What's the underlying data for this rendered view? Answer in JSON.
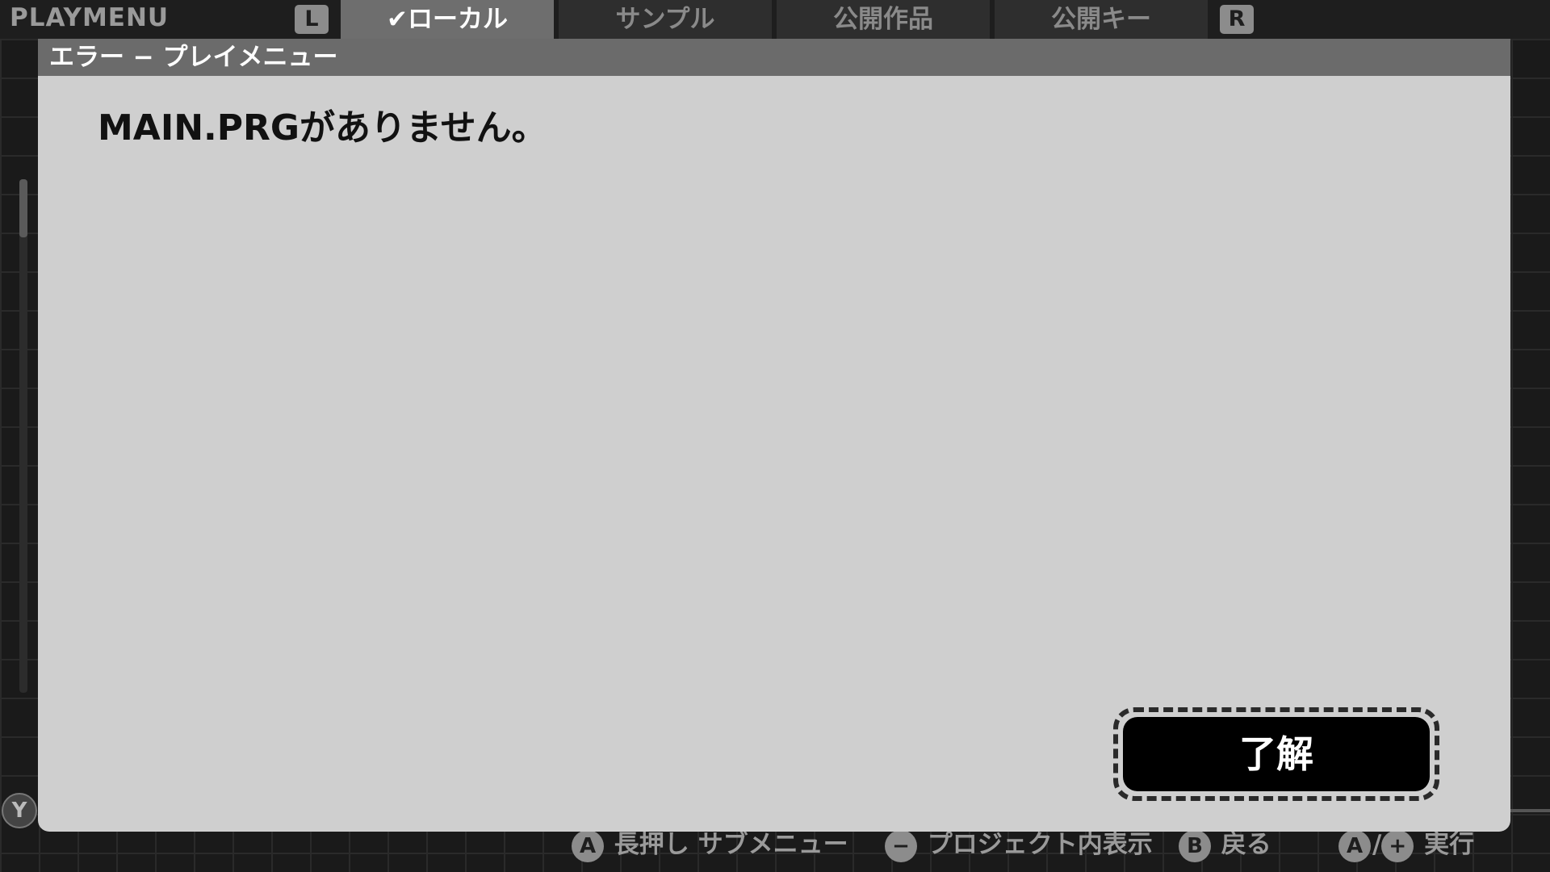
{
  "topbar": {
    "title": "PLAYMENU",
    "left_shoulder": "L",
    "right_shoulder": "R",
    "tabs": [
      {
        "label": "✔ローカル",
        "active": true
      },
      {
        "label": "サンプル",
        "active": false
      },
      {
        "label": "公開作品",
        "active": false
      },
      {
        "label": "公開キー",
        "active": false
      }
    ]
  },
  "side": {
    "y_button": "Y"
  },
  "dialog": {
    "title": "エラー − プレイメニュー",
    "message": "MAIN.PRGがありません。",
    "ok_label": "了解"
  },
  "hints": [
    {
      "button": "A",
      "text": "長押し サブメニュー"
    },
    {
      "button": "−",
      "text": "プロジェクト内表示"
    },
    {
      "button": "B",
      "text": "戻る"
    },
    {
      "button": "A",
      "button2": "+",
      "text": "実行"
    }
  ],
  "colors": {
    "dialog_bg": "#cfcfcf",
    "dialog_header": "#6b6b6b",
    "active_tab": "#6e6e6e",
    "button_bg": "#000000"
  }
}
